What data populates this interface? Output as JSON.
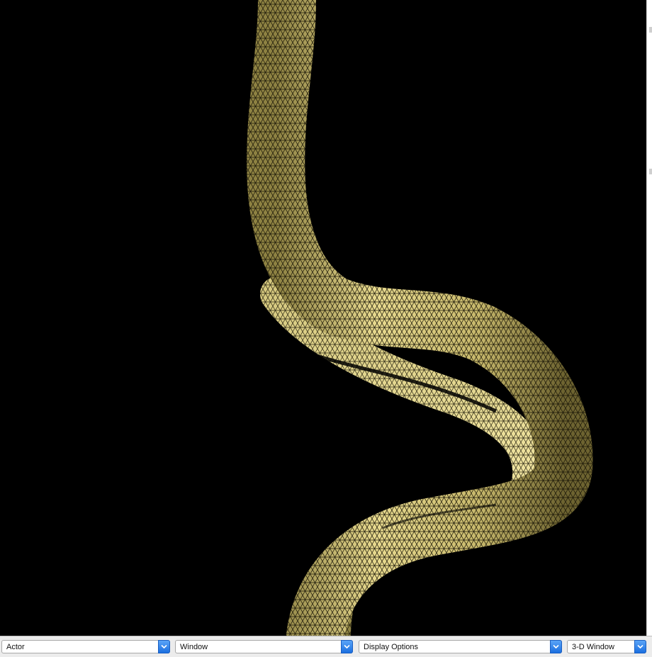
{
  "viewport": {
    "background": "#000000",
    "mesh_color": "#e4d68a"
  },
  "toolbar": {
    "selects": [
      {
        "label": "Actor"
      },
      {
        "label": "Window"
      },
      {
        "label": "Display Options"
      },
      {
        "label": "3-D Window"
      }
    ],
    "accent": "#2b82f0"
  },
  "icons": {
    "dropdown": "chevron-down-icon"
  }
}
